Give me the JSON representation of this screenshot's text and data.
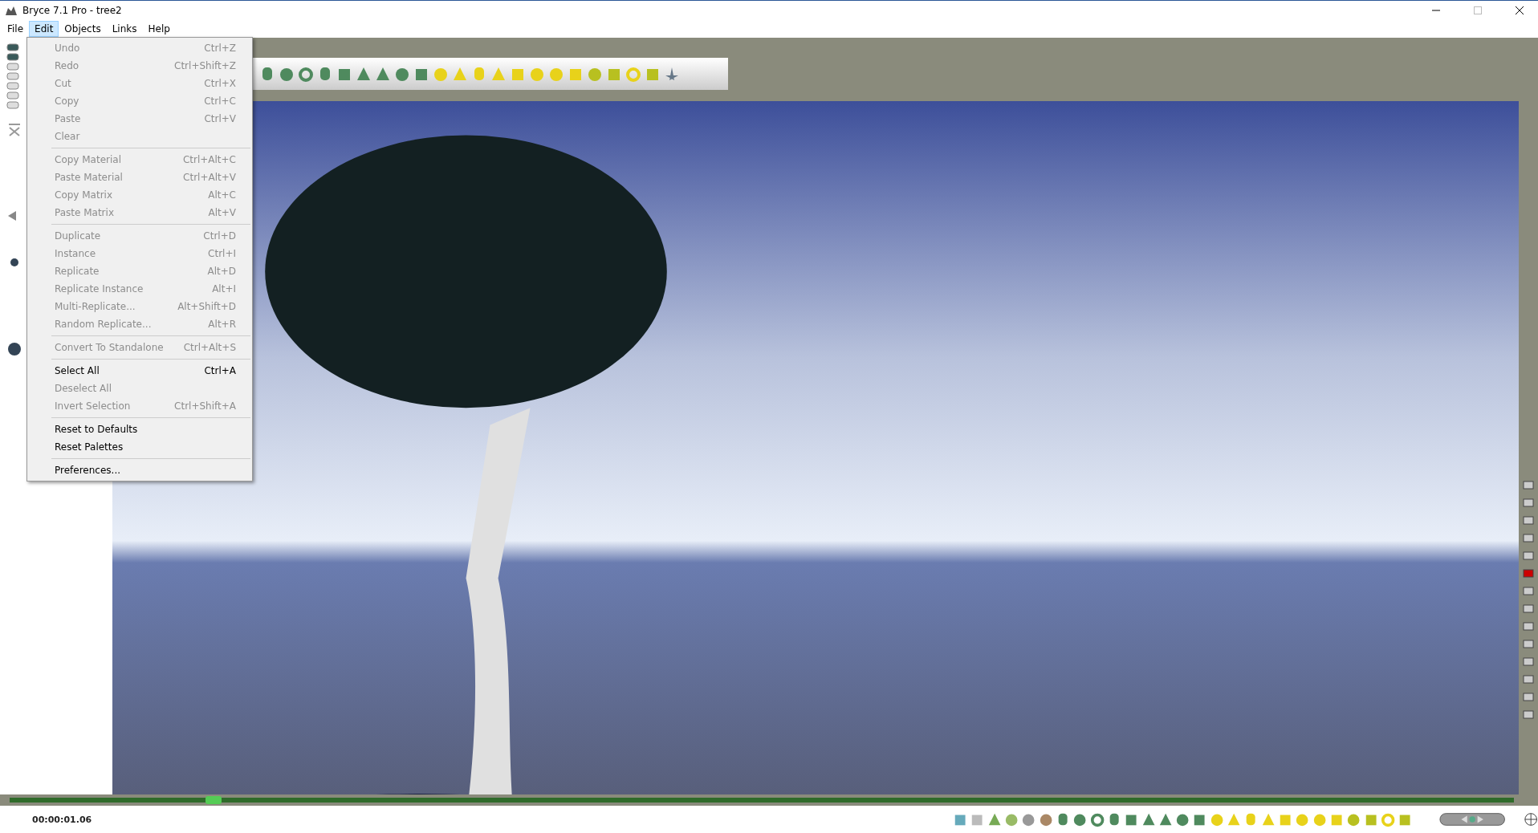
{
  "window": {
    "title": "Bryce 7.1  Pro - tree2"
  },
  "menu_bar": [
    {
      "label": "File",
      "selected": false
    },
    {
      "label": "Edit",
      "selected": true
    },
    {
      "label": "Objects",
      "selected": false
    },
    {
      "label": "Links",
      "selected": false
    },
    {
      "label": "Help",
      "selected": false
    }
  ],
  "edit_menu": {
    "groups": [
      [
        {
          "label": "Undo",
          "shortcut": "Ctrl+Z",
          "disabled": true
        },
        {
          "label": "Redo",
          "shortcut": "Ctrl+Shift+Z",
          "disabled": true
        },
        {
          "label": "Cut",
          "shortcut": "Ctrl+X",
          "disabled": true
        },
        {
          "label": "Copy",
          "shortcut": "Ctrl+C",
          "disabled": true
        },
        {
          "label": "Paste",
          "shortcut": "Ctrl+V",
          "disabled": true
        },
        {
          "label": "Clear",
          "disabled": true
        }
      ],
      [
        {
          "label": "Copy Material",
          "shortcut": "Ctrl+Alt+C",
          "disabled": true
        },
        {
          "label": "Paste Material",
          "shortcut": "Ctrl+Alt+V",
          "disabled": true
        },
        {
          "label": "Copy Matrix",
          "shortcut": "Alt+C",
          "disabled": true
        },
        {
          "label": "Paste Matrix",
          "shortcut": "Alt+V",
          "disabled": true
        }
      ],
      [
        {
          "label": "Duplicate",
          "shortcut": "Ctrl+D",
          "disabled": true
        },
        {
          "label": "Instance",
          "shortcut": "Ctrl+I",
          "disabled": true
        },
        {
          "label": "Replicate",
          "shortcut": "Alt+D",
          "disabled": true
        },
        {
          "label": "Replicate Instance",
          "shortcut": "Alt+I",
          "disabled": true
        },
        {
          "label": "Multi-Replicate...",
          "shortcut": "Alt+Shift+D",
          "disabled": true
        },
        {
          "label": "Random Replicate...",
          "shortcut": "Alt+R",
          "disabled": true
        }
      ],
      [
        {
          "label": "Convert To Standalone",
          "shortcut": "Ctrl+Alt+S",
          "disabled": true
        }
      ],
      [
        {
          "label": "Select All",
          "shortcut": "Ctrl+A",
          "disabled": false
        },
        {
          "label": "Deselect All",
          "disabled": true
        },
        {
          "label": "Invert Selection",
          "shortcut": "Ctrl+Shift+A",
          "disabled": true
        }
      ],
      [
        {
          "label": "Reset to Defaults",
          "disabled": false
        },
        {
          "label": "Reset Palettes",
          "disabled": false
        }
      ],
      [
        {
          "label": "Preferences...",
          "disabled": false
        }
      ]
    ]
  },
  "timeline": {
    "time": "00:00:01.06",
    "level": 0.13
  }
}
